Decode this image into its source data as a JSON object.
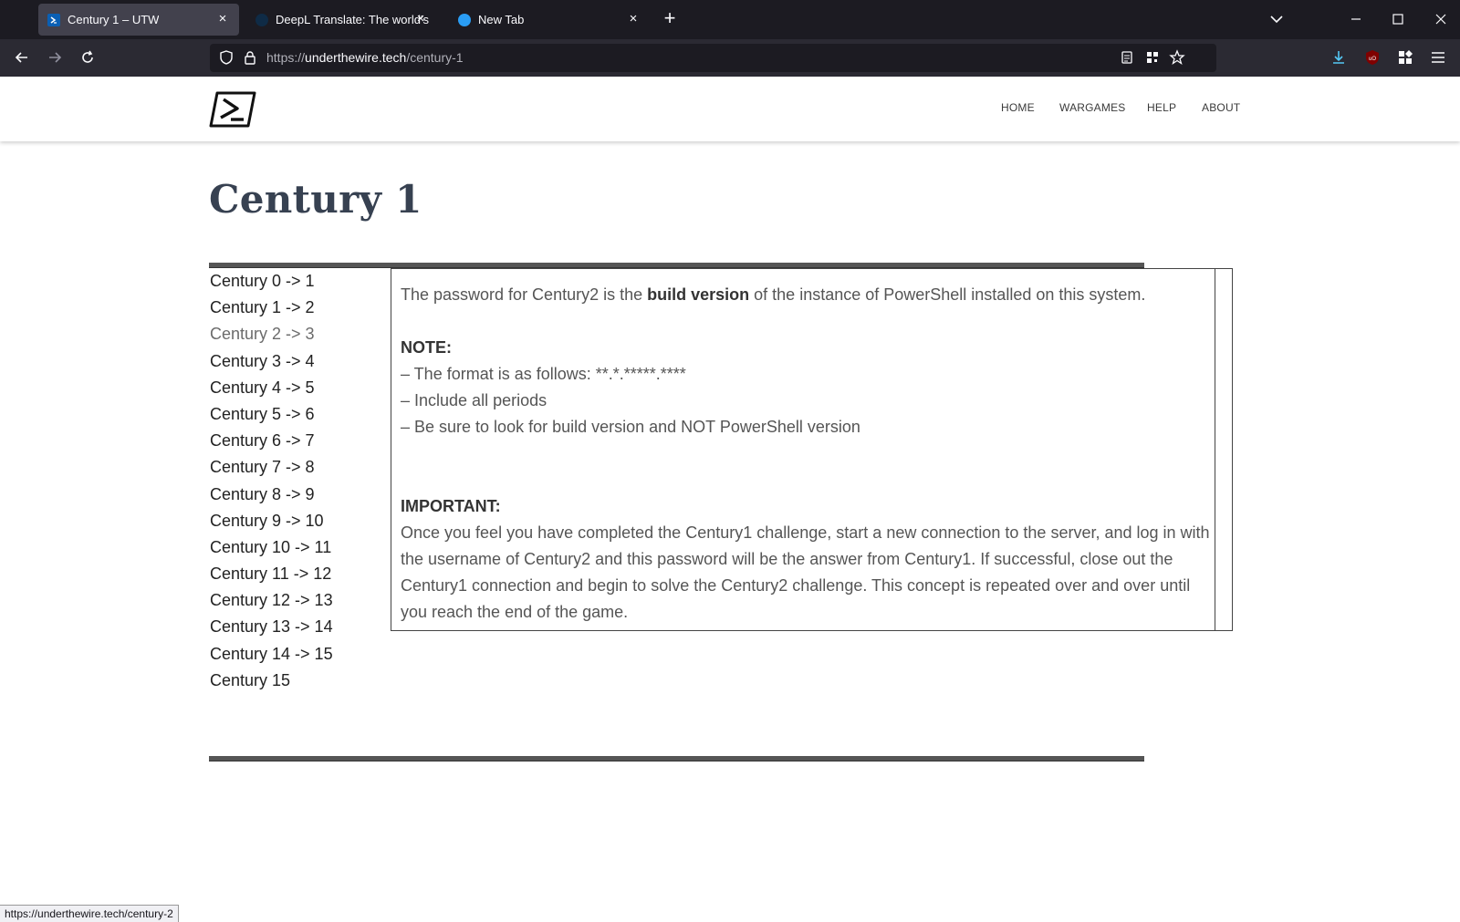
{
  "browser": {
    "tabs": [
      {
        "title": "Century 1 – UTW",
        "active": true
      },
      {
        "title": "DeepL Translate: The world's mc",
        "active": false
      },
      {
        "title": "New Tab",
        "active": false
      }
    ],
    "url": {
      "scheme": "https://",
      "host": "underthewire.tech",
      "path": "/century-1"
    },
    "status_url": "https://underthewire.tech/century-2"
  },
  "site": {
    "nav": [
      "HOME",
      "WARGAMES",
      "HELP",
      "ABOUT"
    ],
    "title": "Century 1"
  },
  "sidebar": {
    "items": [
      {
        "label": "Century 0 -> 1"
      },
      {
        "label": "Century 1 -> 2"
      },
      {
        "label": "Century 2 -> 3",
        "visited": true
      },
      {
        "label": "Century 3 -> 4"
      },
      {
        "label": "Century 4 -> 5"
      },
      {
        "label": "Century 5 -> 6"
      },
      {
        "label": "Century 6 -> 7"
      },
      {
        "label": "Century 7 -> 8"
      },
      {
        "label": "Century 8 -> 9"
      },
      {
        "label": "Century 9 -> 10"
      },
      {
        "label": "Century 10 -> 11"
      },
      {
        "label": "Century 11 -> 12"
      },
      {
        "label": "Century 12 -> 13"
      },
      {
        "label": "Century 13 -> 14"
      },
      {
        "label": "Century 14 -> 15"
      },
      {
        "label": "Century 15"
      }
    ]
  },
  "content": {
    "intro_before": "The password for Century2 is the ",
    "intro_bold": "build version",
    "intro_after": " of the instance of PowerShell installed on this system.",
    "note_heading": "NOTE:",
    "note_items": [
      "– The format is as follows: **.*.*****.****",
      "– Include all periods",
      "– Be sure to look for build version and NOT PowerShell version"
    ],
    "important_heading": "IMPORTANT:",
    "important_text": "Once you feel you have completed the Century1 challenge, start a new connection to the server, and log in with the username of Century2 and this password will be the answer from Century1. If successful, close out the Century1 connection and begin to solve the Century2 challenge. This concept is repeated over and over until you reach the end of the game."
  },
  "colors": {
    "tabbar_bg": "#1c1b22",
    "toolbar_bg": "#2b2a33",
    "heading": "#374151",
    "rule": "#555555"
  }
}
